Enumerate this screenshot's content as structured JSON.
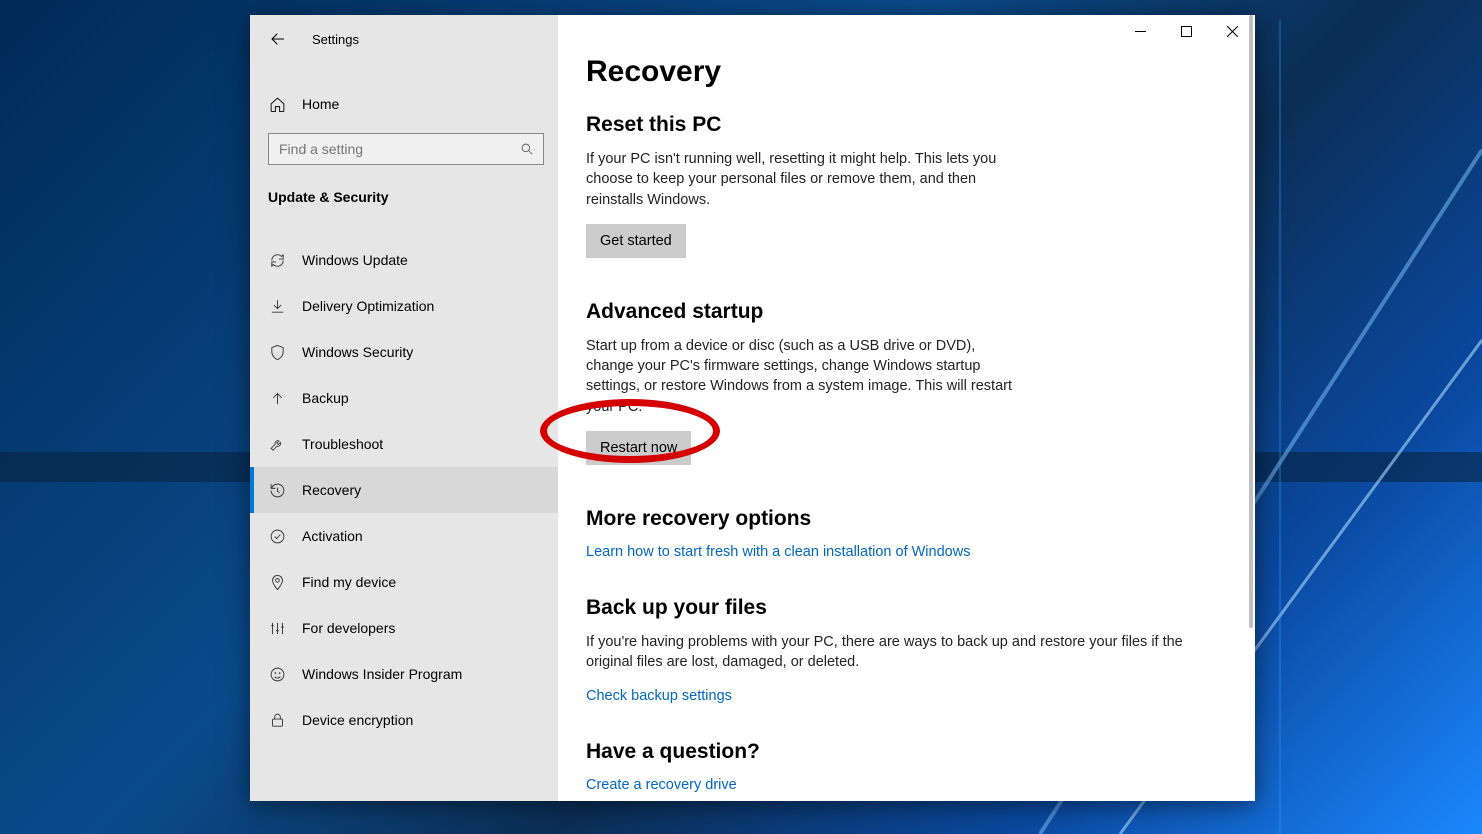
{
  "window": {
    "app_title": "Settings"
  },
  "sidebar": {
    "home_label": "Home",
    "search_placeholder": "Find a setting",
    "section_label": "Update & Security",
    "items": [
      {
        "label": "Windows Update"
      },
      {
        "label": "Delivery Optimization"
      },
      {
        "label": "Windows Security"
      },
      {
        "label": "Backup"
      },
      {
        "label": "Troubleshoot"
      },
      {
        "label": "Recovery"
      },
      {
        "label": "Activation"
      },
      {
        "label": "Find my device"
      },
      {
        "label": "For developers"
      },
      {
        "label": "Windows Insider Program"
      },
      {
        "label": "Device encryption"
      }
    ]
  },
  "main": {
    "page_title": "Recovery",
    "reset": {
      "heading": "Reset this PC",
      "desc": "If your PC isn't running well, resetting it might help. This lets you choose to keep your personal files or remove them, and then reinstalls Windows.",
      "button": "Get started"
    },
    "advanced": {
      "heading": "Advanced startup",
      "desc": "Start up from a device or disc (such as a USB drive or DVD), change your PC's firmware settings, change Windows startup settings, or restore Windows from a system image. This will restart your PC.",
      "button": "Restart now"
    },
    "more": {
      "heading": "More recovery options",
      "link": "Learn how to start fresh with a clean installation of Windows"
    },
    "backup": {
      "heading": "Back up your files",
      "desc": "If you're having problems with your PC, there are ways to back up and restore your files if the original files are lost, damaged, or deleted.",
      "link": "Check backup settings"
    },
    "question": {
      "heading": "Have a question?",
      "link": "Create a recovery drive"
    }
  },
  "highlight": {
    "target": "restart-now-button"
  }
}
